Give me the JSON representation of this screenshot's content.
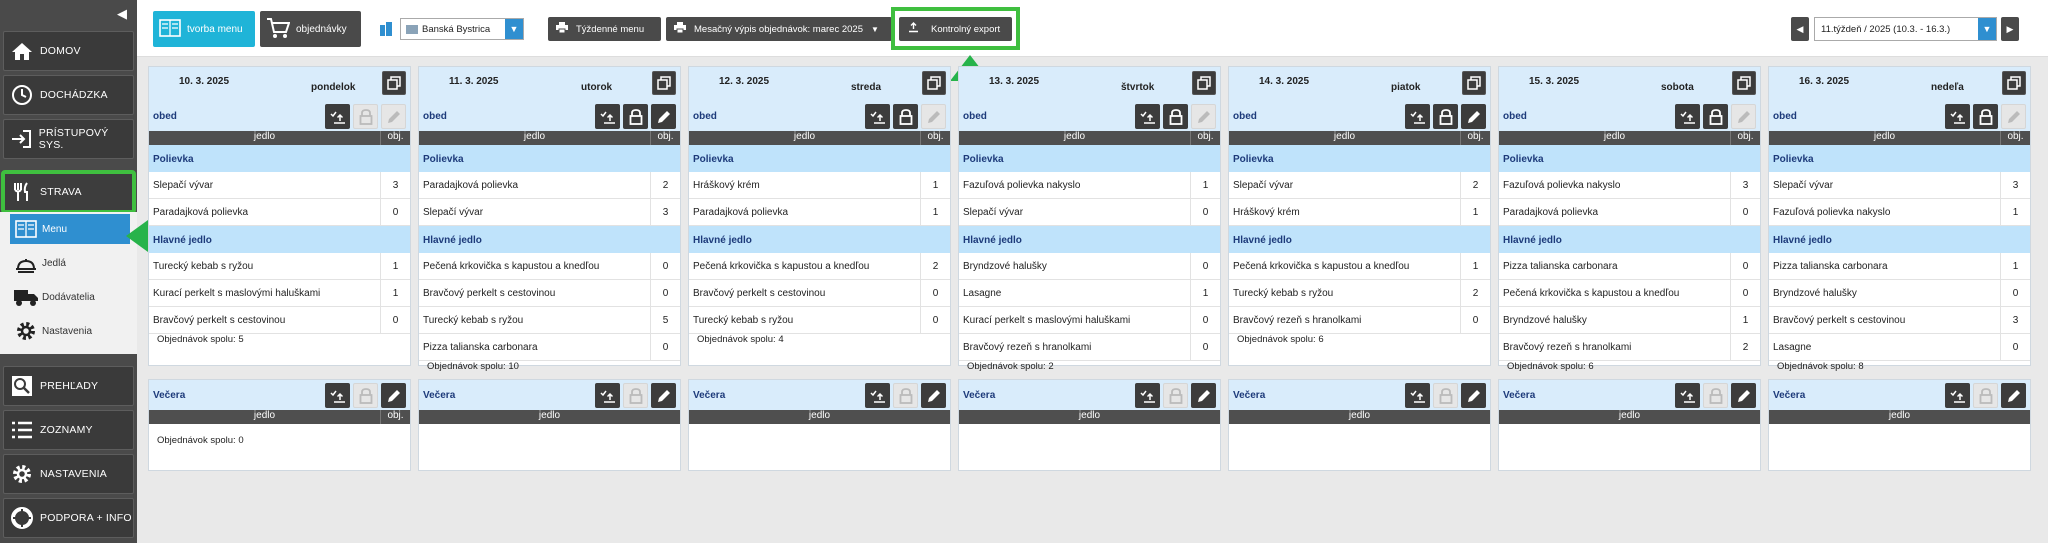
{
  "sidebar": {
    "items": [
      {
        "label": "DOMOV",
        "icon": "home-icon"
      },
      {
        "label": "DOCHÁDZKA",
        "icon": "clock-icon"
      },
      {
        "label": "PRÍSTUPOVÝ SYS.",
        "icon": "login-icon"
      },
      {
        "label": "STRAVA",
        "icon": "utensils-icon"
      },
      {
        "label": "PREHĽADY",
        "icon": "search-icon"
      },
      {
        "label": "ZOZNAMY",
        "icon": "list-icon"
      },
      {
        "label": "NASTAVENIA",
        "icon": "gear-icon"
      },
      {
        "label": "PODPORA + INFO",
        "icon": "support-icon"
      }
    ],
    "submenu": [
      {
        "label": "Menu",
        "icon": "menu-icon"
      },
      {
        "label": "Jedlá",
        "icon": "dishes-icon"
      },
      {
        "label": "Dodávatelia",
        "icon": "truck-icon"
      },
      {
        "label": "Nastavenia",
        "icon": "gear-icon"
      }
    ]
  },
  "toolbar": {
    "tvorba_menu": "tvorba menu",
    "objednavky": "objednávky",
    "location": "Banská Bystrica",
    "tyzdenne_menu": "Týždenné menu",
    "mesacny_vypis": "Mesačný výpis objednávok: marec 2025",
    "kontrolny_export": "Kontrolný export",
    "week": "11.týždeň / 2025 (10.3. - 16.3.)"
  },
  "labels": {
    "obed": "obed",
    "vecera": "Večera",
    "jedlo": "jedlo",
    "obj": "obj.",
    "polievka": "Polievka",
    "hlavne": "Hlavné jedlo",
    "objednavok_spolu": "Objednávok spolu:"
  },
  "days": [
    {
      "date": "10. 3. 2025",
      "name": "pondelok",
      "soups": [
        {
          "n": "Slepačí vývar",
          "q": "3"
        },
        {
          "n": "Paradajková polievka",
          "q": "0"
        }
      ],
      "mains": [
        {
          "n": "Turecký kebab s ryžou",
          "q": "1"
        },
        {
          "n": "Kurací perkelt s maslovými haluškami",
          "q": "1"
        },
        {
          "n": "Bravčový perkelt s cestovinou",
          "q": "0"
        }
      ],
      "total": "5",
      "vtotal": "0"
    },
    {
      "date": "11. 3. 2025",
      "name": "utorok",
      "soups": [
        {
          "n": "Paradajková polievka",
          "q": "2"
        },
        {
          "n": "Slepačí vývar",
          "q": "3"
        }
      ],
      "mains": [
        {
          "n": "Pečená krkovička s kapustou a knedľou",
          "q": "0"
        },
        {
          "n": "Bravčový perkelt s cestovinou",
          "q": "0"
        },
        {
          "n": "Turecký kebab s ryžou",
          "q": "5"
        },
        {
          "n": "Pizza talianska carbonara",
          "q": "0"
        }
      ],
      "total": "10"
    },
    {
      "date": "12. 3. 2025",
      "name": "streda",
      "soups": [
        {
          "n": "Hráškový krém",
          "q": "1"
        },
        {
          "n": "Paradajková polievka",
          "q": "1"
        }
      ],
      "mains": [
        {
          "n": "Pečená krkovička s kapustou a knedľou",
          "q": "2"
        },
        {
          "n": "Bravčový perkelt s cestovinou",
          "q": "0"
        },
        {
          "n": "Turecký kebab s ryžou",
          "q": "0"
        }
      ],
      "total": "4"
    },
    {
      "date": "13. 3. 2025",
      "name": "štvrtok",
      "soups": [
        {
          "n": "Fazuľová polievka nakyslo",
          "q": "1"
        },
        {
          "n": "Slepačí vývar",
          "q": "0"
        }
      ],
      "mains": [
        {
          "n": "Bryndzové halušky",
          "q": "0"
        },
        {
          "n": "Lasagne",
          "q": "1"
        },
        {
          "n": "Kurací perkelt s maslovými haluškami",
          "q": "0"
        },
        {
          "n": "Bravčový rezeň s hranolkami",
          "q": "0"
        }
      ],
      "total": "2"
    },
    {
      "date": "14. 3. 2025",
      "name": "piatok",
      "soups": [
        {
          "n": "Slepačí vývar",
          "q": "2"
        },
        {
          "n": "Hráškový krém",
          "q": "1"
        }
      ],
      "mains": [
        {
          "n": "Pečená krkovička s kapustou a knedľou",
          "q": "1"
        },
        {
          "n": "Turecký kebab s ryžou",
          "q": "2"
        },
        {
          "n": "Bravčový rezeň s hranolkami",
          "q": "0"
        }
      ],
      "total": "6"
    },
    {
      "date": "15. 3. 2025",
      "name": "sobota",
      "soups": [
        {
          "n": "Fazuľová polievka nakyslo",
          "q": "3"
        },
        {
          "n": "Paradajková polievka",
          "q": "0"
        }
      ],
      "mains": [
        {
          "n": "Pizza talianska carbonara",
          "q": "0"
        },
        {
          "n": "Pečená krkovička s kapustou a knedľou",
          "q": "0"
        },
        {
          "n": "Bryndzové halušky",
          "q": "1"
        },
        {
          "n": "Bravčový rezeň s hranolkami",
          "q": "2"
        }
      ],
      "total": "6"
    },
    {
      "date": "16. 3. 2025",
      "name": "nedeľa",
      "soups": [
        {
          "n": "Slepačí vývar",
          "q": "3"
        },
        {
          "n": "Fazuľová polievka nakyslo",
          "q": "1"
        }
      ],
      "mains": [
        {
          "n": "Pizza talianska carbonara",
          "q": "1"
        },
        {
          "n": "Bryndzové halušky",
          "q": "0"
        },
        {
          "n": "Bravčový perkelt s cestovinou",
          "q": "3"
        },
        {
          "n": "Lasagne",
          "q": "0"
        }
      ],
      "total": "8"
    }
  ],
  "colors": {
    "accent": "#2f8fd0",
    "highlight": "#3fbf3f",
    "panel": "#d9ecfb",
    "category": "#bfe3fb"
  }
}
